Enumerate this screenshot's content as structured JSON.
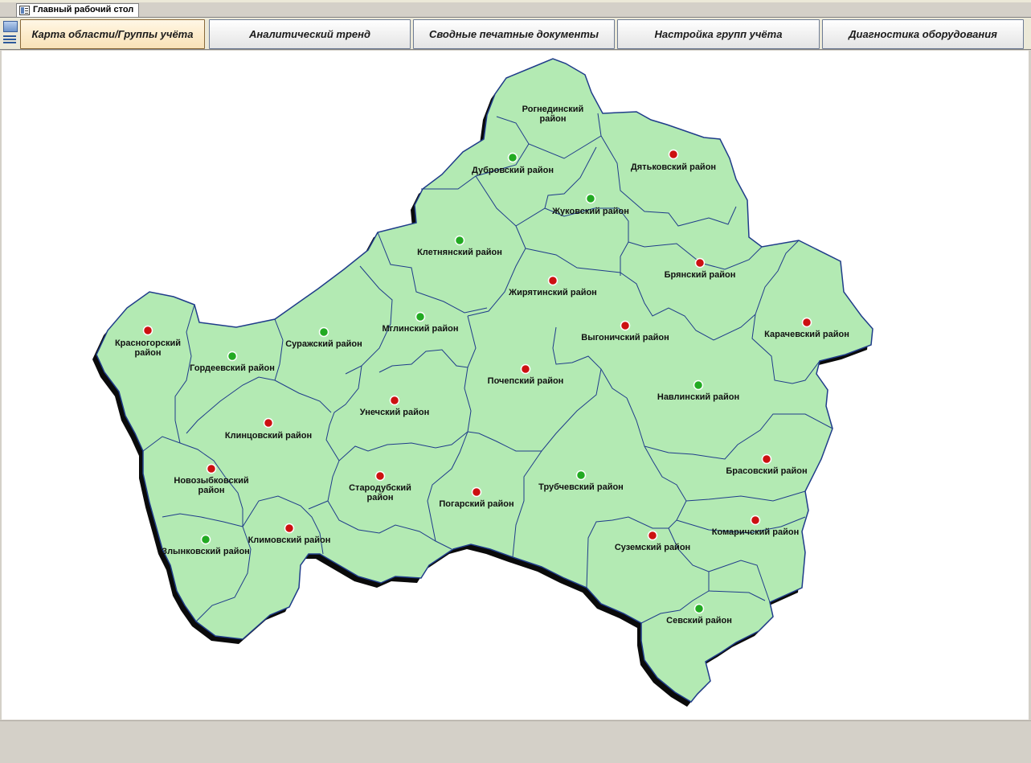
{
  "window": {
    "tab_title": "Главный рабочий стол"
  },
  "toolbar": {
    "buttons": [
      {
        "label": "Карта области/Группы учёта",
        "active": true
      },
      {
        "label": "Аналитический тренд",
        "active": false
      },
      {
        "label": "Сводные печатные документы",
        "active": false
      },
      {
        "label": "Настройка групп учёта",
        "active": false
      },
      {
        "label": "Диагностика оборудования",
        "active": false
      }
    ]
  },
  "map": {
    "fill_color": "#b3eab3",
    "border_color": "#1f3c8a",
    "status_colors": {
      "ok": "#22aa22",
      "alarm": "#cc1111"
    },
    "districts": [
      {
        "name": "Рогнединский район",
        "status": "none"
      },
      {
        "name": "Дубровский район",
        "status": "ok"
      },
      {
        "name": "Дятьковский район",
        "status": "alarm"
      },
      {
        "name": "Жуковский район",
        "status": "ok"
      },
      {
        "name": "Клетнянский район",
        "status": "ok"
      },
      {
        "name": "Брянский район",
        "status": "alarm"
      },
      {
        "name": "Жирятинский район",
        "status": "alarm"
      },
      {
        "name": "Выгоничский район",
        "status": "alarm"
      },
      {
        "name": "Карачевский район",
        "status": "alarm"
      },
      {
        "name": "Красногорский район",
        "status": "alarm"
      },
      {
        "name": "Гордеевский район",
        "status": "ok"
      },
      {
        "name": "Суражский район",
        "status": "ok"
      },
      {
        "name": "Мглинский район",
        "status": "ok"
      },
      {
        "name": "Почепский район",
        "status": "alarm"
      },
      {
        "name": "Навлинский район",
        "status": "ok"
      },
      {
        "name": "Унечский район",
        "status": "alarm"
      },
      {
        "name": "Клинцовский район",
        "status": "alarm"
      },
      {
        "name": "Новозыбковский район",
        "status": "alarm"
      },
      {
        "name": "Стародубский район",
        "status": "alarm"
      },
      {
        "name": "Погарский район",
        "status": "alarm"
      },
      {
        "name": "Трубчевский район",
        "status": "ok"
      },
      {
        "name": "Брасовский район",
        "status": "alarm"
      },
      {
        "name": "Комаричский район",
        "status": "alarm"
      },
      {
        "name": "Суземский район",
        "status": "alarm"
      },
      {
        "name": "Климовский район",
        "status": "alarm"
      },
      {
        "name": "Злынковский район",
        "status": "ok"
      },
      {
        "name": "Севский район",
        "status": "ok"
      }
    ]
  }
}
